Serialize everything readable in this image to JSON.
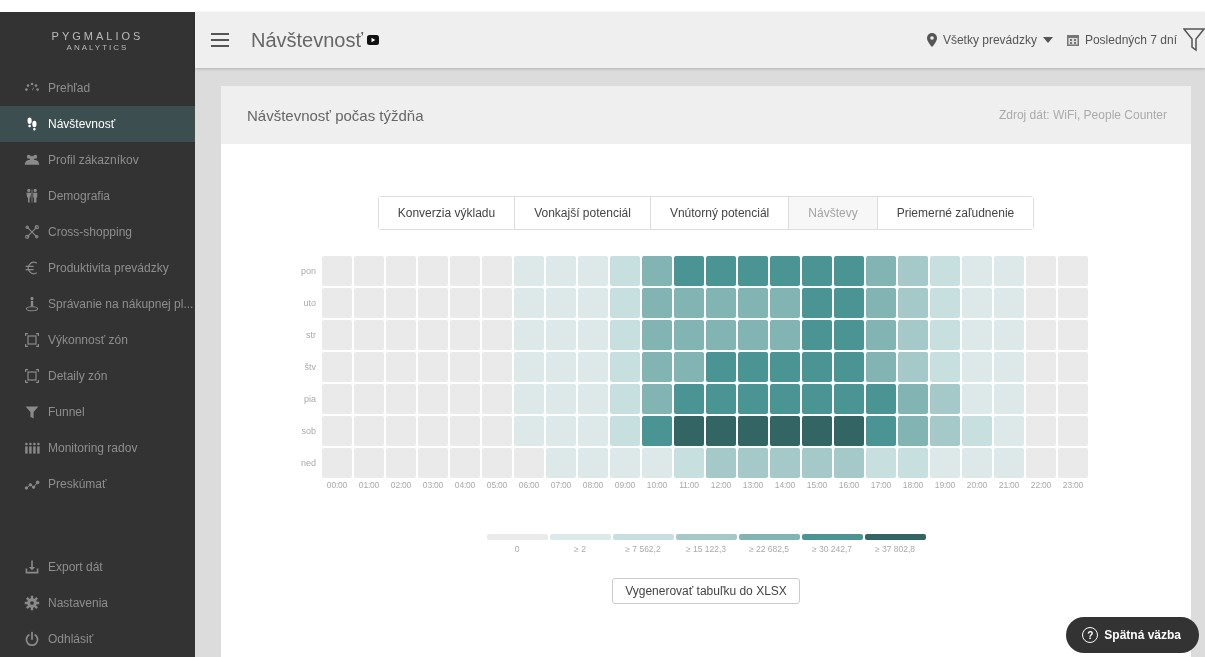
{
  "logo": {
    "name": "PYGMALIOS",
    "tagline": "ANALYTICS"
  },
  "sidebar": {
    "items": [
      {
        "label": "Prehľad",
        "selected": false
      },
      {
        "label": "Návštevnosť",
        "selected": true
      },
      {
        "label": "Profil zákazníkov",
        "selected": false
      },
      {
        "label": "Demografia",
        "selected": false
      },
      {
        "label": "Cross-shopping",
        "selected": false
      },
      {
        "label": "Produktivita prevádzky",
        "selected": false
      },
      {
        "label": "Správanie na nákupnej pl...",
        "selected": false
      },
      {
        "label": "Výkonnosť zón",
        "selected": false
      },
      {
        "label": "Detaily zón",
        "selected": false
      },
      {
        "label": "Funnel",
        "selected": false
      },
      {
        "label": "Monitoring radov",
        "selected": false
      },
      {
        "label": "Preskúmať",
        "selected": false
      }
    ],
    "bottom_items": [
      {
        "label": "Export dát"
      },
      {
        "label": "Nastavenia"
      },
      {
        "label": "Odhlásiť"
      }
    ]
  },
  "header": {
    "title": "Návštevnosť",
    "store_filter": "Všetky prevádzky",
    "date_filter": "Posledných 7 dní"
  },
  "card": {
    "title": "Návštevnosť počas týždňa",
    "source": "Zdroj dát: WiFi, People Counter",
    "tabs": [
      {
        "label": "Konverzia výkladu",
        "selected": false
      },
      {
        "label": "Vonkajší potenciál",
        "selected": false
      },
      {
        "label": "Vnútorný potenciál",
        "selected": false
      },
      {
        "label": "Návštevy",
        "selected": true
      },
      {
        "label": "Priemerné zaľudnenie",
        "selected": false
      }
    ],
    "heatmap": {
      "hours": [
        "00:00",
        "01:00",
        "02:00",
        "03:00",
        "04:00",
        "05:00",
        "06:00",
        "07:00",
        "08:00",
        "09:00",
        "10:00",
        "11:00",
        "12:00",
        "13:00",
        "14:00",
        "15:00",
        "16:00",
        "17:00",
        "18:00",
        "19:00",
        "20:00",
        "21:00",
        "22:00",
        "23:00"
      ],
      "rows": [
        {
          "day": "pon",
          "cells": [
            {
              "color": "#eaeaea"
            },
            {
              "color": "#eaeaea"
            },
            {
              "color": "#eaeaea"
            },
            {
              "color": "#eaeaea"
            },
            {
              "color": "#eaeaea"
            },
            {
              "color": "#eaeaea"
            },
            {
              "color": "#dce9e8"
            },
            {
              "color": "#dce9e8"
            },
            {
              "color": "#dce9e8"
            },
            {
              "color": "#c8dfe0"
            },
            {
              "color": "#82b4b3"
            },
            {
              "color": "#4a9494"
            },
            {
              "color": "#4a9494"
            },
            {
              "color": "#4a9494"
            },
            {
              "color": "#4a9494"
            },
            {
              "color": "#4a9494"
            },
            {
              "color": "#4a9494"
            },
            {
              "color": "#82b4b3"
            },
            {
              "color": "#a5c8c8"
            },
            {
              "color": "#c8dfe0"
            },
            {
              "color": "#dce9e8"
            },
            {
              "color": "#dce9e8"
            },
            {
              "color": "#eaeaea"
            },
            {
              "color": "#eaeaea"
            }
          ]
        },
        {
          "day": "uto",
          "cells": [
            {
              "color": "#eaeaea"
            },
            {
              "color": "#eaeaea"
            },
            {
              "color": "#eaeaea"
            },
            {
              "color": "#eaeaea"
            },
            {
              "color": "#eaeaea"
            },
            {
              "color": "#eaeaea"
            },
            {
              "color": "#dce9e8"
            },
            {
              "color": "#dce9e8"
            },
            {
              "color": "#dce9e8"
            },
            {
              "color": "#c8dfe0"
            },
            {
              "color": "#82b4b3"
            },
            {
              "color": "#82b4b3"
            },
            {
              "color": "#82b4b3"
            },
            {
              "color": "#82b4b3"
            },
            {
              "color": "#82b4b3"
            },
            {
              "color": "#4a9494"
            },
            {
              "color": "#4a9494"
            },
            {
              "color": "#82b4b3"
            },
            {
              "color": "#a5c8c8"
            },
            {
              "color": "#c8dfe0"
            },
            {
              "color": "#dce9e8"
            },
            {
              "color": "#dce9e8"
            },
            {
              "color": "#eaeaea"
            },
            {
              "color": "#eaeaea"
            }
          ]
        },
        {
          "day": "str",
          "cells": [
            {
              "color": "#eaeaea"
            },
            {
              "color": "#eaeaea"
            },
            {
              "color": "#eaeaea"
            },
            {
              "color": "#eaeaea"
            },
            {
              "color": "#eaeaea"
            },
            {
              "color": "#eaeaea"
            },
            {
              "color": "#dce9e8"
            },
            {
              "color": "#dce9e8"
            },
            {
              "color": "#dce9e8"
            },
            {
              "color": "#c8dfe0"
            },
            {
              "color": "#82b4b3"
            },
            {
              "color": "#82b4b3"
            },
            {
              "color": "#82b4b3"
            },
            {
              "color": "#82b4b3"
            },
            {
              "color": "#82b4b3"
            },
            {
              "color": "#4a9494"
            },
            {
              "color": "#4a9494"
            },
            {
              "color": "#82b4b3"
            },
            {
              "color": "#a5c8c8"
            },
            {
              "color": "#c8dfe0"
            },
            {
              "color": "#dce9e8"
            },
            {
              "color": "#dce9e8"
            },
            {
              "color": "#eaeaea"
            },
            {
              "color": "#eaeaea"
            }
          ]
        },
        {
          "day": "štv",
          "cells": [
            {
              "color": "#eaeaea"
            },
            {
              "color": "#eaeaea"
            },
            {
              "color": "#eaeaea"
            },
            {
              "color": "#eaeaea"
            },
            {
              "color": "#eaeaea"
            },
            {
              "color": "#eaeaea"
            },
            {
              "color": "#dce9e8"
            },
            {
              "color": "#dce9e8"
            },
            {
              "color": "#dce9e8"
            },
            {
              "color": "#c8dfe0"
            },
            {
              "color": "#82b4b3"
            },
            {
              "color": "#82b4b3"
            },
            {
              "color": "#4a9494"
            },
            {
              "color": "#4a9494"
            },
            {
              "color": "#4a9494"
            },
            {
              "color": "#4a9494"
            },
            {
              "color": "#4a9494"
            },
            {
              "color": "#82b4b3"
            },
            {
              "color": "#a5c8c8"
            },
            {
              "color": "#c8dfe0"
            },
            {
              "color": "#dce9e8"
            },
            {
              "color": "#dce9e8"
            },
            {
              "color": "#eaeaea"
            },
            {
              "color": "#eaeaea"
            }
          ]
        },
        {
          "day": "pia",
          "cells": [
            {
              "color": "#eaeaea"
            },
            {
              "color": "#eaeaea"
            },
            {
              "color": "#eaeaea"
            },
            {
              "color": "#eaeaea"
            },
            {
              "color": "#eaeaea"
            },
            {
              "color": "#eaeaea"
            },
            {
              "color": "#dce9e8"
            },
            {
              "color": "#dce9e8"
            },
            {
              "color": "#dce9e8"
            },
            {
              "color": "#c8dfe0"
            },
            {
              "color": "#82b4b3"
            },
            {
              "color": "#4a9494"
            },
            {
              "color": "#4a9494"
            },
            {
              "color": "#4a9494"
            },
            {
              "color": "#4a9494"
            },
            {
              "color": "#4a9494"
            },
            {
              "color": "#4a9494"
            },
            {
              "color": "#4a9494"
            },
            {
              "color": "#82b4b3"
            },
            {
              "color": "#a5c8c8"
            },
            {
              "color": "#dce9e8"
            },
            {
              "color": "#dce9e8"
            },
            {
              "color": "#eaeaea"
            },
            {
              "color": "#eaeaea"
            }
          ]
        },
        {
          "day": "sob",
          "cells": [
            {
              "color": "#eaeaea"
            },
            {
              "color": "#eaeaea"
            },
            {
              "color": "#eaeaea"
            },
            {
              "color": "#eaeaea"
            },
            {
              "color": "#eaeaea"
            },
            {
              "color": "#eaeaea"
            },
            {
              "color": "#dce9e8"
            },
            {
              "color": "#dce9e8"
            },
            {
              "color": "#dce9e8"
            },
            {
              "color": "#c8dfe0"
            },
            {
              "color": "#4a9494"
            },
            {
              "color": "#336565"
            },
            {
              "color": "#336565"
            },
            {
              "color": "#336565"
            },
            {
              "color": "#336565"
            },
            {
              "color": "#336565"
            },
            {
              "color": "#336565"
            },
            {
              "color": "#4a9494"
            },
            {
              "color": "#82b4b3"
            },
            {
              "color": "#a5c8c8"
            },
            {
              "color": "#c8dfe0"
            },
            {
              "color": "#dce9e8"
            },
            {
              "color": "#eaeaea"
            },
            {
              "color": "#eaeaea"
            }
          ]
        },
        {
          "day": "ned",
          "cells": [
            {
              "color": "#eaeaea"
            },
            {
              "color": "#eaeaea"
            },
            {
              "color": "#eaeaea"
            },
            {
              "color": "#eaeaea"
            },
            {
              "color": "#eaeaea"
            },
            {
              "color": "#eaeaea"
            },
            {
              "color": "#eaeaea"
            },
            {
              "color": "#dce9e8"
            },
            {
              "color": "#dce9e8"
            },
            {
              "color": "#dce9e8"
            },
            {
              "color": "#dce9e8"
            },
            {
              "color": "#c8dfe0"
            },
            {
              "color": "#a5c8c8"
            },
            {
              "color": "#a5c8c8"
            },
            {
              "color": "#a5c8c8"
            },
            {
              "color": "#a5c8c8"
            },
            {
              "color": "#a5c8c8"
            },
            {
              "color": "#c8dfe0"
            },
            {
              "color": "#c8dfe0"
            },
            {
              "color": "#dce9e8"
            },
            {
              "color": "#dce9e8"
            },
            {
              "color": "#dce9e8"
            },
            {
              "color": "#eaeaea"
            },
            {
              "color": "#eaeaea"
            }
          ]
        }
      ]
    },
    "legend": [
      {
        "label": "0",
        "color": "#eaeaea"
      },
      {
        "label": "≥ 2",
        "color": "#dce9e8"
      },
      {
        "label": "≥ 7 562,2",
        "color": "#c8dfe0"
      },
      {
        "label": "≥ 15 122,3",
        "color": "#a5c8c8"
      },
      {
        "label": "≥ 22 682,5",
        "color": "#82b4b3"
      },
      {
        "label": "≥ 30 242,7",
        "color": "#4a9494"
      },
      {
        "label": "≥ 37 802,8",
        "color": "#336565"
      }
    ],
    "export_button": "Vygenerovať tabuľku do XLSX"
  },
  "feedback_button": {
    "label": "Spätná väzba",
    "icon": "?"
  }
}
